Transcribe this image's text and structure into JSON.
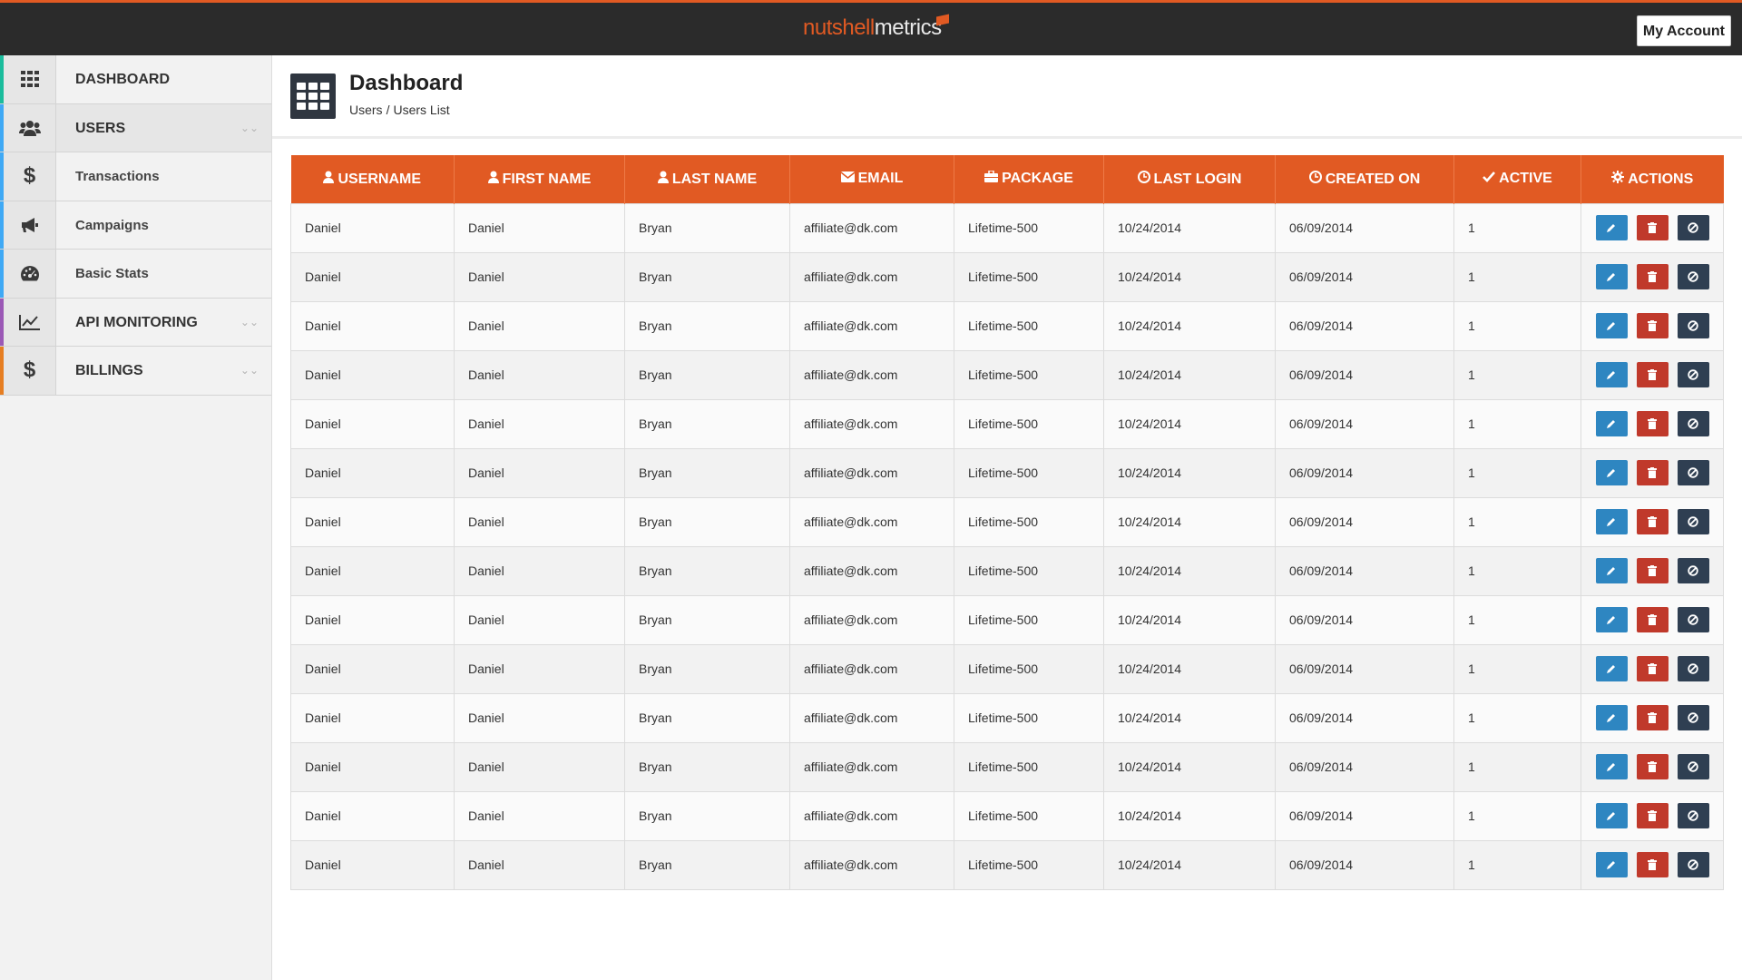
{
  "app": {
    "logo_part1": "nutshell",
    "logo_part2": "metrics",
    "account_label": "My Account",
    "accent_color": "#e15a23"
  },
  "sidebar": {
    "items": [
      {
        "label": "DASHBOARD",
        "icon": "grid-icon",
        "stripe": "#1abc9c",
        "active": false,
        "expandable": false
      },
      {
        "label": "USERS",
        "icon": "users-icon",
        "stripe": "#3fa9f5",
        "active": true,
        "expandable": true
      },
      {
        "label": "Transactions",
        "icon": "dollar-icon",
        "stripe": "#3fa9f5",
        "active": false,
        "expandable": false
      },
      {
        "label": "Campaigns",
        "icon": "megaphone-icon",
        "stripe": "#3fa9f5",
        "active": false,
        "expandable": false
      },
      {
        "label": "Basic Stats",
        "icon": "dashboard-gauge-icon",
        "stripe": "#3fa9f5",
        "active": false,
        "expandable": false
      },
      {
        "label": "API MONITORING",
        "icon": "line-chart-icon",
        "stripe": "#9b59b6",
        "active": false,
        "expandable": true
      },
      {
        "label": "BILLINGS",
        "icon": "dollar-icon",
        "stripe": "#e67e22",
        "active": false,
        "expandable": true
      }
    ]
  },
  "header": {
    "title": "Dashboard",
    "breadcrumb": [
      "Users",
      "Users List"
    ]
  },
  "table": {
    "columns": [
      {
        "label": "USERNAME",
        "icon": "user-icon"
      },
      {
        "label": "FIRST NAME",
        "icon": "user-icon"
      },
      {
        "label": "LAST NAME",
        "icon": "user-icon"
      },
      {
        "label": "EMAIL",
        "icon": "envelope-icon"
      },
      {
        "label": "PACKAGE",
        "icon": "briefcase-icon"
      },
      {
        "label": "LAST LOGIN",
        "icon": "clock-icon"
      },
      {
        "label": "CREATED ON",
        "icon": "clock-icon"
      },
      {
        "label": "ACTIVE",
        "icon": "check-icon"
      },
      {
        "label": "ACTIONS",
        "icon": "gear-icon"
      }
    ],
    "rows": [
      [
        "Daniel",
        "Daniel",
        "Bryan",
        "affiliate@dk.com",
        "Lifetime-500",
        "10/24/2014",
        "06/09/2014",
        "1"
      ],
      [
        "Daniel",
        "Daniel",
        "Bryan",
        "affiliate@dk.com",
        "Lifetime-500",
        "10/24/2014",
        "06/09/2014",
        "1"
      ],
      [
        "Daniel",
        "Daniel",
        "Bryan",
        "affiliate@dk.com",
        "Lifetime-500",
        "10/24/2014",
        "06/09/2014",
        "1"
      ],
      [
        "Daniel",
        "Daniel",
        "Bryan",
        "affiliate@dk.com",
        "Lifetime-500",
        "10/24/2014",
        "06/09/2014",
        "1"
      ],
      [
        "Daniel",
        "Daniel",
        "Bryan",
        "affiliate@dk.com",
        "Lifetime-500",
        "10/24/2014",
        "06/09/2014",
        "1"
      ],
      [
        "Daniel",
        "Daniel",
        "Bryan",
        "affiliate@dk.com",
        "Lifetime-500",
        "10/24/2014",
        "06/09/2014",
        "1"
      ],
      [
        "Daniel",
        "Daniel",
        "Bryan",
        "affiliate@dk.com",
        "Lifetime-500",
        "10/24/2014",
        "06/09/2014",
        "1"
      ],
      [
        "Daniel",
        "Daniel",
        "Bryan",
        "affiliate@dk.com",
        "Lifetime-500",
        "10/24/2014",
        "06/09/2014",
        "1"
      ],
      [
        "Daniel",
        "Daniel",
        "Bryan",
        "affiliate@dk.com",
        "Lifetime-500",
        "10/24/2014",
        "06/09/2014",
        "1"
      ],
      [
        "Daniel",
        "Daniel",
        "Bryan",
        "affiliate@dk.com",
        "Lifetime-500",
        "10/24/2014",
        "06/09/2014",
        "1"
      ],
      [
        "Daniel",
        "Daniel",
        "Bryan",
        "affiliate@dk.com",
        "Lifetime-500",
        "10/24/2014",
        "06/09/2014",
        "1"
      ],
      [
        "Daniel",
        "Daniel",
        "Bryan",
        "affiliate@dk.com",
        "Lifetime-500",
        "10/24/2014",
        "06/09/2014",
        "1"
      ],
      [
        "Daniel",
        "Daniel",
        "Bryan",
        "affiliate@dk.com",
        "Lifetime-500",
        "10/24/2014",
        "06/09/2014",
        "1"
      ],
      [
        "Daniel",
        "Daniel",
        "Bryan",
        "affiliate@dk.com",
        "Lifetime-500",
        "10/24/2014",
        "06/09/2014",
        "1"
      ]
    ],
    "actions": [
      {
        "name": "edit",
        "icon": "pencil-icon",
        "color": "#2e86c1"
      },
      {
        "name": "delete",
        "icon": "trash-icon",
        "color": "#c0392b"
      },
      {
        "name": "ban",
        "icon": "ban-icon",
        "color": "#2f3f52"
      }
    ]
  }
}
